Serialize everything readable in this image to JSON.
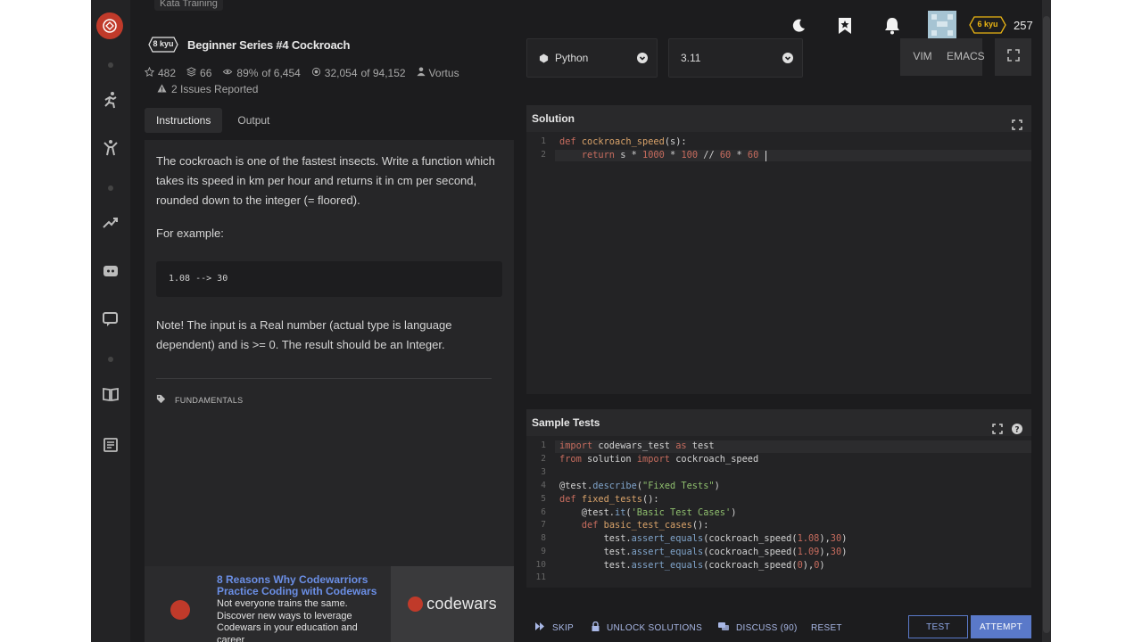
{
  "breadcrumb": "Kata Training",
  "kata": {
    "rank": "8 kyu",
    "title": "Beginner Series #4 Cockroach",
    "stars": "482",
    "collections": "66",
    "satisfaction_pct": "89%",
    "satisfaction_of": "of 6,454",
    "completed": "32,054",
    "completed_of": "of 94,152",
    "author": "Vortus",
    "issues": "2 Issues Reported"
  },
  "tabs": [
    {
      "label": "Instructions",
      "active": true
    },
    {
      "label": "Output",
      "active": false
    }
  ],
  "instructions": {
    "para1": "The cockroach is one of the fastest insects. Write a function which takes its speed in km per hour and returns it in cm per second, rounded down to the integer (= floored).",
    "para2": "For example:",
    "example": "1.08 --> 30",
    "para3": "Note! The input is a Real number (actual type is language dependent) and is >= 0. The result should be an Integer.",
    "tag": "FUNDAMENTALS"
  },
  "ad": {
    "title": "8 Reasons Why Codewarriors Practice Coding with Codewars",
    "text": "Not everyone trains the same. Discover new ways to leverage Codewars in your education and career",
    "brand": "codewars"
  },
  "user": {
    "rank": "6 kyu",
    "honor": "257"
  },
  "editor": {
    "language": "Python",
    "version": "3.11",
    "vim_label": "VIM",
    "emacs_label": "EMACS",
    "solution_title": "Solution",
    "tests_title": "Sample Tests"
  },
  "solution_lines": [
    "1",
    "2"
  ],
  "test_lines": [
    "1",
    "2",
    "3",
    "4",
    "5",
    "6",
    "7",
    "8",
    "9",
    "10",
    "11"
  ],
  "actions": {
    "skip": "SKIP",
    "unlock": "UNLOCK SOLUTIONS",
    "discuss": "DISCUSS (90)",
    "reset": "RESET",
    "test": "TEST",
    "attempt": "ATTEMPT"
  },
  "colors": {
    "brand_red": "#c03a2a",
    "accent_blue": "#5a79c9",
    "rank_yellow": "#ecb613"
  }
}
